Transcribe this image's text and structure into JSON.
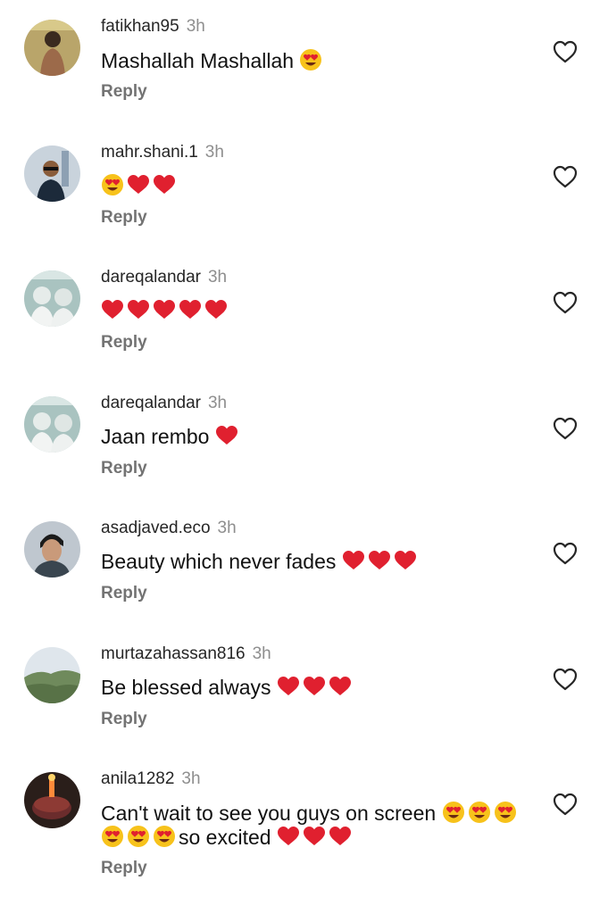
{
  "comments": [
    {
      "username": "fatikhan95",
      "time": "3h",
      "text": "Mashallah Mashallah",
      "emojis": [
        "heart-eyes"
      ],
      "reply": "Reply"
    },
    {
      "username": "mahr.shani.1",
      "time": "3h",
      "text": "",
      "emojis": [
        "heart-eyes",
        "red-heart",
        "red-heart"
      ],
      "reply": "Reply"
    },
    {
      "username": "dareqalandar",
      "time": "3h",
      "text": "",
      "emojis": [
        "red-heart",
        "red-heart",
        "red-heart",
        "red-heart",
        "red-heart"
      ],
      "reply": "Reply"
    },
    {
      "username": "dareqalandar",
      "time": "3h",
      "text": "Jaan rembo",
      "emojis": [
        "red-heart"
      ],
      "reply": "Reply"
    },
    {
      "username": "asadjaved.eco",
      "time": "3h",
      "text": "Beauty which never fades",
      "emojis": [
        "red-heart",
        "red-heart",
        "red-heart"
      ],
      "reply": "Reply"
    },
    {
      "username": "murtazahassan816",
      "time": "3h",
      "text": "Be blessed always",
      "emojis": [
        "red-heart",
        "red-heart",
        "red-heart"
      ],
      "reply": "Reply"
    },
    {
      "username": "anila1282",
      "time": "3h",
      "text": "Can't wait to see you guys on screen",
      "text_line2": "so excited",
      "emojis": [
        "heart-eyes",
        "heart-eyes",
        "heart-eyes"
      ],
      "emojis_line2_before": [
        "heart-eyes",
        "heart-eyes",
        "heart-eyes"
      ],
      "emojis_line2_after": [
        "red-heart",
        "red-heart",
        "red-heart"
      ],
      "reply": "Reply"
    }
  ],
  "icons": {
    "like": "heart-outline-icon",
    "red_heart": "red-heart-emoji",
    "heart_eyes": "heart-eyes-emoji"
  },
  "colors": {
    "username": "#262626",
    "time": "#8e8e8e",
    "reply": "#737373",
    "heart": "#e0202f"
  }
}
